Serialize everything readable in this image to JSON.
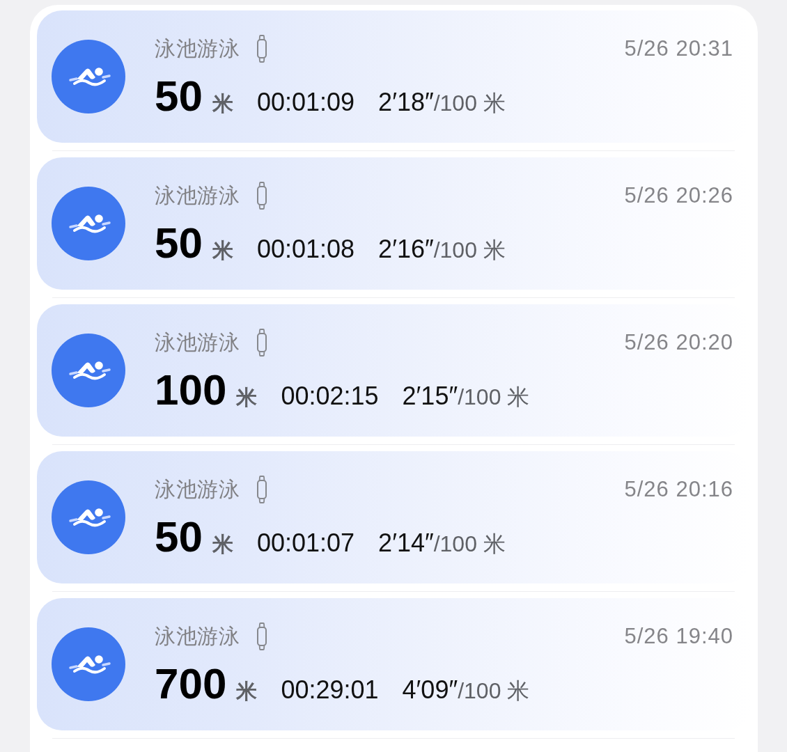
{
  "workouts": [
    {
      "title": "泳池游泳",
      "distance": "50",
      "distance_unit": "米",
      "duration": "00:01:09",
      "pace": "2′18″",
      "pace_unit": "/100 米",
      "time": "5/26 20:31"
    },
    {
      "title": "泳池游泳",
      "distance": "50",
      "distance_unit": "米",
      "duration": "00:01:08",
      "pace": "2′16″",
      "pace_unit": "/100 米",
      "time": "5/26 20:26"
    },
    {
      "title": "泳池游泳",
      "distance": "100",
      "distance_unit": "米",
      "duration": "00:02:15",
      "pace": "2′15″",
      "pace_unit": "/100 米",
      "time": "5/26 20:20"
    },
    {
      "title": "泳池游泳",
      "distance": "50",
      "distance_unit": "米",
      "duration": "00:01:07",
      "pace": "2′14″",
      "pace_unit": "/100 米",
      "time": "5/26 20:16"
    },
    {
      "title": "泳池游泳",
      "distance": "700",
      "distance_unit": "米",
      "duration": "00:29:01",
      "pace": "4′09″",
      "pace_unit": "/100 米",
      "time": "5/26 19:40"
    }
  ]
}
